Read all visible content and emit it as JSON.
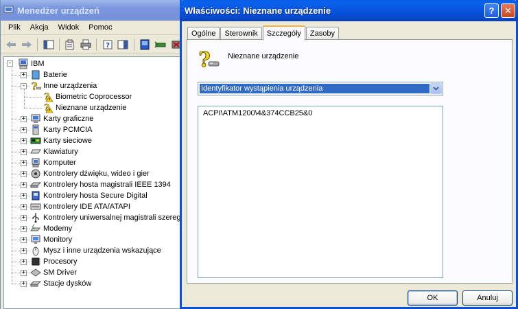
{
  "device_manager": {
    "title": "Menedżer urządzeń",
    "menu": [
      "Plik",
      "Akcja",
      "Widok",
      "Pomoc"
    ],
    "tree": {
      "root": "IBM",
      "items": [
        {
          "label": "Baterie",
          "icon": "battery-icon",
          "level": 1,
          "expander": "+"
        },
        {
          "label": "Inne urządzenia",
          "icon": "unknown-device-icon",
          "level": 1,
          "expander": "-"
        },
        {
          "label": "Biometric Coprocessor",
          "icon": "unknown-device-warning-icon",
          "level": 2,
          "expander": ""
        },
        {
          "label": "Nieznane urządzenie",
          "icon": "unknown-device-warning-icon",
          "level": 2,
          "expander": ""
        },
        {
          "label": "Karty graficzne",
          "icon": "display-adapter-icon",
          "level": 1,
          "expander": "+"
        },
        {
          "label": "Karty PCMCIA",
          "icon": "pcmcia-card-icon",
          "level": 1,
          "expander": "+"
        },
        {
          "label": "Karty sieciowe",
          "icon": "network-card-icon",
          "level": 1,
          "expander": "+"
        },
        {
          "label": "Klawiatury",
          "icon": "keyboard-icon",
          "level": 1,
          "expander": "+"
        },
        {
          "label": "Komputer",
          "icon": "computer-icon",
          "level": 1,
          "expander": "+"
        },
        {
          "label": "Kontrolery dźwięku, wideo i gier",
          "icon": "sound-icon",
          "level": 1,
          "expander": "+"
        },
        {
          "label": "Kontrolery hosta magistrali IEEE 1394",
          "icon": "ieee1394-icon",
          "level": 1,
          "expander": "+"
        },
        {
          "label": "Kontrolery hosta Secure Digital",
          "icon": "sd-host-icon",
          "level": 1,
          "expander": "+"
        },
        {
          "label": "Kontrolery IDE ATA/ATAPI",
          "icon": "ide-controller-icon",
          "level": 1,
          "expander": "+"
        },
        {
          "label": "Kontrolery uniwersalnej magistrali szerego",
          "icon": "usb-icon",
          "level": 1,
          "expander": "+"
        },
        {
          "label": "Modemy",
          "icon": "modem-icon",
          "level": 1,
          "expander": "+"
        },
        {
          "label": "Monitory",
          "icon": "monitor-icon",
          "level": 1,
          "expander": "+"
        },
        {
          "label": "Mysz i inne urządzenia wskazujące",
          "icon": "mouse-icon",
          "level": 1,
          "expander": "+"
        },
        {
          "label": "Procesory",
          "icon": "processor-icon",
          "level": 1,
          "expander": "+"
        },
        {
          "label": "SM Driver",
          "icon": "sm-driver-icon",
          "level": 1,
          "expander": "+"
        },
        {
          "label": "Stacje dysków",
          "icon": "disk-drive-icon",
          "level": 1,
          "expander": "+"
        }
      ]
    }
  },
  "dialog": {
    "title": "Właściwości: Nieznane urządzenie",
    "tabs": [
      "Ogólne",
      "Sterownik",
      "Szczegóły",
      "Zasoby"
    ],
    "active_tab": "Szczegóły",
    "device_name": "Nieznane urządzenie",
    "property_select": "Identyfikator wystąpienia urządzenia",
    "values": [
      "ACPI\\ATM1200\\4&374CCB25&0"
    ],
    "ok_label": "OK",
    "cancel_label": "Anuluj"
  }
}
